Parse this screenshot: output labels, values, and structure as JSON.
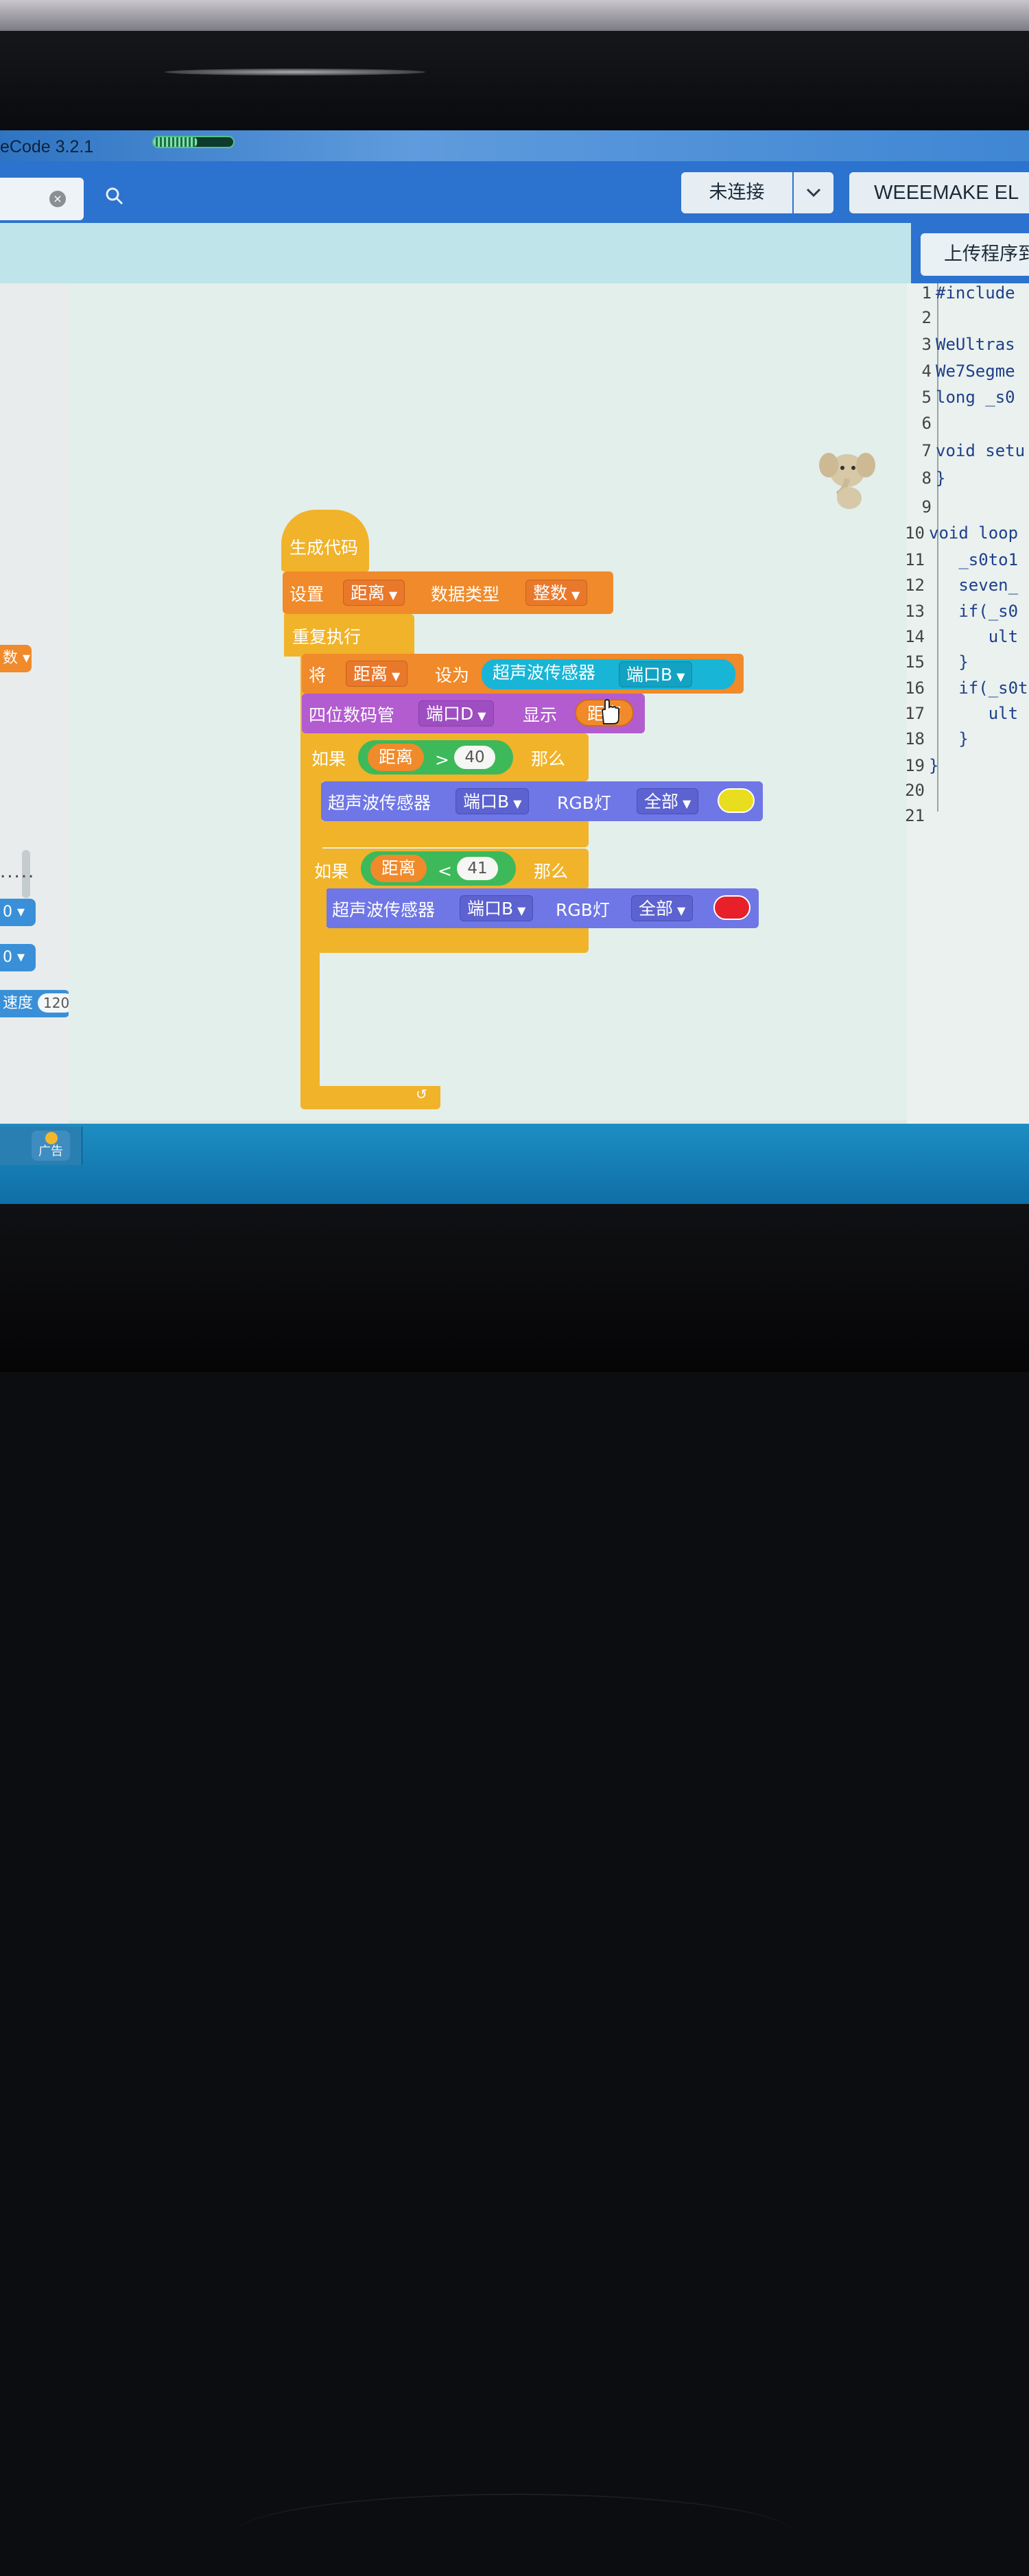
{
  "window": {
    "title": "eCode 3.2.1",
    "progress_fraction": 0.55
  },
  "toolbar": {
    "connection_label": "未连接",
    "device_label": "WEEEMAKE EL",
    "upload_label": "上传程序到"
  },
  "palette": {
    "block1_label": "数 ▾",
    "block2_label": "0 ▾",
    "block3_label": "0 ▾",
    "block4_label": "速度",
    "block4_value": "120",
    "dots": "....."
  },
  "blocks": {
    "hat_label": "生成代码",
    "set_label": "设置",
    "var_name": "距离",
    "datatype_label": "数据类型",
    "datatype_value": "整数",
    "repeat_label": "重复执行",
    "assign_label": "将",
    "set_to_label": "设为",
    "ultrasonic_label": "超声波传感器",
    "port_b": "端口B",
    "port_d": "端口D",
    "seg_label": "四位数码管",
    "display_label": "显示",
    "if_label": "如果",
    "then_label": "那么",
    "op_gt": ">",
    "op_lt": "<",
    "val_40": "40",
    "val_41": "41",
    "rgb_label": "RGB灯",
    "all_label": "全部",
    "loop_arrow": "↺",
    "colors": {
      "yellow": "#e9de1e",
      "red": "#e8202a"
    }
  },
  "code": {
    "lines": [
      {
        "n": "1",
        "t": "#include"
      },
      {
        "n": "2",
        "t": ""
      },
      {
        "n": "3",
        "t": "WeUltras"
      },
      {
        "n": "4",
        "t": "We7Segme"
      },
      {
        "n": "5",
        "t": "long _s0"
      },
      {
        "n": "6",
        "t": ""
      },
      {
        "n": "7",
        "t": "void setu"
      },
      {
        "n": "8",
        "t": "}"
      },
      {
        "n": "9",
        "t": ""
      },
      {
        "n": "10",
        "t": "void loop"
      },
      {
        "n": "11",
        "t": "   _s0to1"
      },
      {
        "n": "12",
        "t": "   seven_"
      },
      {
        "n": "13",
        "t": "   if(_s0"
      },
      {
        "n": "14",
        "t": "      ult"
      },
      {
        "n": "15",
        "t": "   }"
      },
      {
        "n": "16",
        "t": "   if(_s0t"
      },
      {
        "n": "17",
        "t": "      ult"
      },
      {
        "n": "18",
        "t": "   }"
      },
      {
        "n": "19",
        "t": "}"
      },
      {
        "n": "20",
        "t": ""
      },
      {
        "n": "21",
        "t": ""
      }
    ]
  },
  "taskbar": {
    "ad_label": "广告"
  }
}
